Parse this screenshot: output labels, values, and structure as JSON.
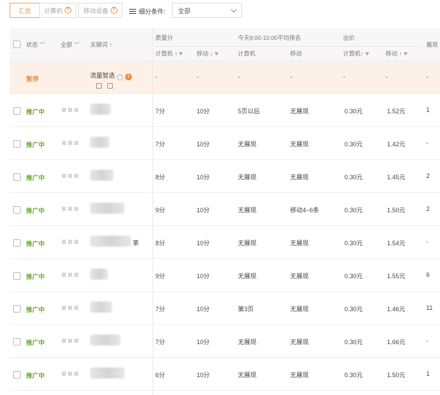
{
  "toolbar": {
    "tabs": [
      {
        "label": "汇总"
      },
      {
        "label": "计算机"
      },
      {
        "label": "移动设备"
      }
    ],
    "filter_label": "细分条件:",
    "filter_value": "全部"
  },
  "table": {
    "headers": {
      "status": "状态",
      "all": "全部",
      "keyword": "关键词 ↑",
      "quality_group": "质量分",
      "rank_group": "今天9:00-10:00平均排名",
      "bid_group": "出价",
      "cut_col": "展现",
      "q_computer": "计算机 ↑",
      "q_mobile": "移动 ↓",
      "r_computer": "计算机",
      "r_mobile": "移动",
      "b_computer": "计算机↑",
      "b_mobile": "移动 ↑"
    },
    "paused_row": {
      "status": "暂停",
      "keyword": "流量智选",
      "q_computer": "-",
      "q_mobile": "-",
      "r_computer": "-",
      "r_mobile": "-",
      "b_computer": "-",
      "b_mobile": "-",
      "impressions": "-"
    },
    "rows": [
      {
        "status": "推广中",
        "q_computer": "7分",
        "q_mobile": "10分",
        "r_computer": "5页以后",
        "r_mobile": "无展现",
        "b_computer": "0.30元",
        "b_mobile": "1.52元",
        "impressions": "1"
      },
      {
        "status": "推广中",
        "q_computer": "7分",
        "q_mobile": "10分",
        "r_computer": "无展现",
        "r_mobile": "无展现",
        "b_computer": "0.30元",
        "b_mobile": "1.42元",
        "impressions": "-"
      },
      {
        "status": "推广中",
        "q_computer": "8分",
        "q_mobile": "10分",
        "r_computer": "无展现",
        "r_mobile": "无展现",
        "b_computer": "0.30元",
        "b_mobile": "1.45元",
        "impressions": "2"
      },
      {
        "status": "推广中",
        "q_computer": "9分",
        "q_mobile": "10分",
        "r_computer": "无展现",
        "r_mobile": "移动4~6条",
        "b_computer": "0.30元",
        "b_mobile": "1.50元",
        "impressions": "2"
      },
      {
        "status": "推广中",
        "keyword_suffix": "革",
        "q_computer": "8分",
        "q_mobile": "10分",
        "r_computer": "无展现",
        "r_mobile": "无展现",
        "b_computer": "0.30元",
        "b_mobile": "1.54元",
        "impressions": "-"
      },
      {
        "status": "推广中",
        "q_computer": "9分",
        "q_mobile": "10分",
        "r_computer": "无展现",
        "r_mobile": "无展现",
        "b_computer": "0.30元",
        "b_mobile": "1.55元",
        "impressions": "6"
      },
      {
        "status": "推广中",
        "q_computer": "7分",
        "q_mobile": "10分",
        "r_computer": "第3页",
        "r_mobile": "无展现",
        "b_computer": "0.30元",
        "b_mobile": "1.46元",
        "impressions": "11"
      },
      {
        "status": "推广中",
        "q_computer": "7分",
        "q_mobile": "10分",
        "r_computer": "无展现",
        "r_mobile": "无展现",
        "b_computer": "0.30元",
        "b_mobile": "1.66元",
        "impressions": "-"
      },
      {
        "status": "推广中",
        "q_computer": "6分",
        "q_mobile": "10分",
        "r_computer": "无展现",
        "r_mobile": "无展现",
        "b_computer": "0.30元",
        "b_mobile": "1.50元",
        "impressions": "1"
      }
    ]
  }
}
